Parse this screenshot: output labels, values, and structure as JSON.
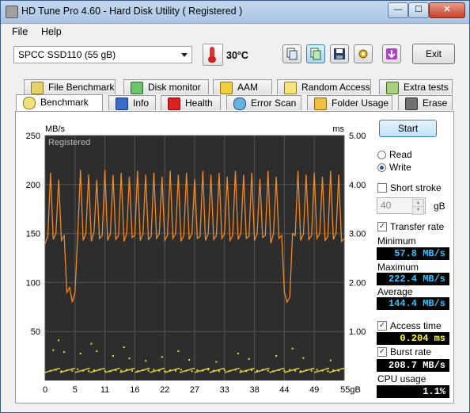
{
  "window": {
    "title": "HD Tune Pro 4.60 - Hard Disk Utility (  Registered )",
    "minimize": "—",
    "maximize": "☐",
    "close": "✕"
  },
  "menu": {
    "file": "File",
    "help": "Help"
  },
  "toolbar": {
    "drive": "SPCC SSD110 (55 gB)",
    "temperature": "30°C",
    "exit": "Exit",
    "icons": [
      "copy-info-icon",
      "copy-screenshot-icon",
      "save-icon",
      "options-icon",
      "download-icon"
    ]
  },
  "tabs_top": [
    {
      "label": "File Benchmark",
      "icon": "file-benchmark-icon"
    },
    {
      "label": "Disk monitor",
      "icon": "disk-monitor-icon"
    },
    {
      "label": "AAM",
      "icon": "speaker-icon"
    },
    {
      "label": "Random Access",
      "icon": "random-access-icon"
    },
    {
      "label": "Extra tests",
      "icon": "extra-tests-icon"
    }
  ],
  "tabs_bottom": [
    {
      "label": "Benchmark",
      "icon": "benchmark-icon",
      "active": true
    },
    {
      "label": "Info",
      "icon": "info-icon"
    },
    {
      "label": "Health",
      "icon": "health-cross-icon"
    },
    {
      "label": "Error Scan",
      "icon": "magnifier-icon"
    },
    {
      "label": "Folder Usage",
      "icon": "folder-icon"
    },
    {
      "label": "Erase",
      "icon": "trash-icon"
    }
  ],
  "side": {
    "start": "Start",
    "read": "Read",
    "write": "Write",
    "mode": "Write",
    "short_stroke": "Short stroke",
    "short_stroke_value": "40",
    "short_stroke_unit": "gB",
    "transfer_rate": "Transfer rate",
    "minimum_label": "Minimum",
    "minimum": "57.8 MB/s",
    "maximum_label": "Maximum",
    "maximum": "222.4 MB/s",
    "average_label": "Average",
    "average": "144.4 MB/s",
    "access_time_label": "Access time",
    "access_time": "0.204 ms",
    "burst_rate_label": "Burst rate",
    "burst_rate": "208.7 MB/s",
    "cpu_label": "CPU usage",
    "cpu": "1.1%"
  },
  "colors": {
    "plot_bg": "#2d2d2d",
    "grid": "#555555",
    "line": "#f08a24",
    "dots": "#e8e040",
    "value_cyan": "#34c3ff",
    "value_yellow": "#ffff33"
  },
  "chart_data": {
    "type": "line",
    "watermark": "Registered",
    "ylabel_left": "MB/s",
    "ylabel_right": "ms",
    "xlim": [
      0,
      55
    ],
    "ylim_left": [
      0,
      250
    ],
    "ylim_right": [
      0,
      5.0
    ],
    "x_ticks": [
      "0",
      "5",
      "11",
      "16",
      "22",
      "27",
      "33",
      "38",
      "44",
      "49",
      "55gB"
    ],
    "y_ticks_left": [
      "250",
      "200",
      "150",
      "100",
      "50"
    ],
    "y_ticks_right": [
      "5.00",
      "4.00",
      "3.00",
      "2.00",
      "1.00"
    ],
    "grid": true,
    "series": [
      {
        "kind": "transfer_rate",
        "x": [
          0,
          0.5,
          1,
          1.5,
          2,
          2.5,
          3,
          3.5,
          4,
          4.5,
          5,
          5.5,
          6,
          6.5,
          7,
          7.5,
          8,
          8.5,
          9,
          9.5,
          10,
          10.5,
          11,
          11.5,
          12,
          12.5,
          13,
          13.5,
          14,
          14.5,
          15,
          15.5,
          16,
          16.5,
          17,
          17.5,
          18,
          18.5,
          19,
          19.5,
          20,
          20.5,
          21,
          21.5,
          22,
          22.5,
          23,
          23.5,
          24,
          24.5,
          25,
          25.5,
          26,
          26.5,
          27,
          27.5,
          28,
          28.5,
          29,
          29.5,
          30,
          30.5,
          31,
          31.5,
          32,
          32.5,
          33,
          33.5,
          34,
          34.5,
          35,
          35.5,
          36,
          36.5,
          37,
          37.5,
          38,
          38.5,
          39,
          39.5,
          40,
          40.5,
          41,
          41.5,
          42,
          42.5,
          43,
          43.5,
          44,
          44.5,
          45,
          45.5,
          46,
          46.5,
          47,
          47.5,
          48,
          48.5,
          49,
          49.5,
          50,
          50.5,
          51,
          51.5,
          52,
          52.5,
          53,
          53.5,
          54,
          54.5,
          55
        ],
        "y": [
          140,
          147,
          212,
          144,
          150,
          205,
          143,
          148,
          90,
          95,
          80,
          90,
          148,
          215,
          143,
          150,
          210,
          142,
          152,
          205,
          145,
          148,
          215,
          143,
          150,
          210,
          144,
          148,
          212,
          142,
          150,
          208,
          146,
          148,
          214,
          143,
          150,
          210,
          144,
          147,
          212,
          145,
          150,
          208,
          143,
          148,
          214,
          145,
          150,
          210,
          142,
          148,
          212,
          144,
          150,
          206,
          145,
          147,
          214,
          143,
          150,
          210,
          144,
          148,
          212,
          145,
          150,
          208,
          143,
          148,
          214,
          144,
          150,
          210,
          145,
          147,
          212,
          143,
          150,
          206,
          146,
          148,
          214,
          140,
          150,
          208,
          145,
          148,
          90,
          80,
          85,
          150,
          148,
          214,
          143,
          150,
          210,
          144,
          148,
          212,
          145,
          150,
          208,
          143,
          147,
          214,
          144,
          150,
          210,
          142,
          145
        ],
        "unit": "MB/s"
      },
      {
        "kind": "access_time",
        "unit": "ms",
        "x": [
          1,
          2,
          3,
          4,
          5,
          6,
          7,
          8,
          9,
          10,
          11,
          12,
          13,
          14,
          15,
          16,
          17,
          18,
          19,
          20,
          21,
          22,
          23,
          24,
          25,
          26,
          27,
          28,
          29,
          30,
          31,
          32,
          33,
          34,
          35,
          36,
          37,
          38,
          39,
          40,
          41,
          42,
          43,
          44,
          45,
          46,
          47,
          48,
          49,
          50,
          51,
          52,
          53,
          54,
          1.5,
          3.5,
          6.5,
          9.5,
          12.5,
          15.5,
          18.5,
          21.5,
          26.5,
          31.5,
          37.5,
          42.5,
          47.5,
          52.5,
          2.5,
          8.5,
          14.5,
          24.5,
          35.5,
          45.5
        ],
        "y": [
          0.2,
          0.22,
          0.19,
          0.21,
          0.2,
          0.23,
          0.2,
          0.19,
          0.21,
          0.22,
          0.2,
          0.19,
          0.21,
          0.2,
          0.22,
          0.2,
          0.19,
          0.21,
          0.2,
          0.22,
          0.2,
          0.19,
          0.21,
          0.2,
          0.22,
          0.2,
          0.19,
          0.21,
          0.2,
          0.22,
          0.2,
          0.19,
          0.21,
          0.2,
          0.22,
          0.2,
          0.19,
          0.21,
          0.2,
          0.22,
          0.2,
          0.19,
          0.21,
          0.2,
          0.22,
          0.2,
          0.19,
          0.21,
          0.2,
          0.22,
          0.2,
          0.19,
          0.21,
          0.2,
          0.62,
          0.58,
          0.55,
          0.6,
          0.5,
          0.45,
          0.4,
          0.48,
          0.42,
          0.38,
          0.44,
          0.5,
          0.46,
          0.41,
          0.82,
          0.75,
          0.68,
          0.6,
          0.55,
          0.65
        ]
      }
    ]
  }
}
